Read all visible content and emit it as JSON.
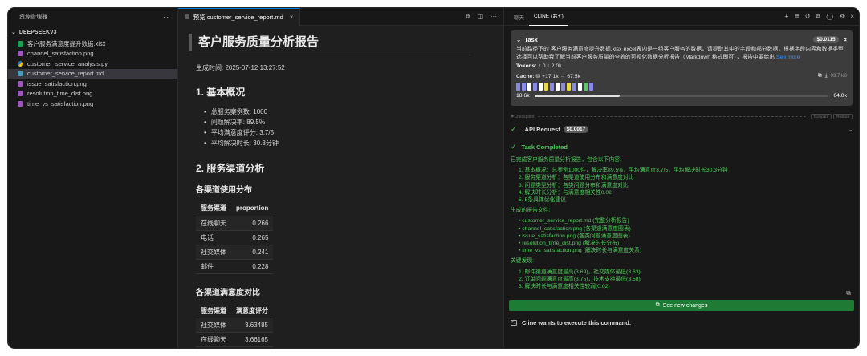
{
  "sidebar": {
    "title": "资源管理器",
    "more": "···",
    "section": "DEEPSEEKV3",
    "files": [
      {
        "name": "客户服务满意度提升数据.xlsx",
        "type": "xlsx"
      },
      {
        "name": "channel_satisfaction.png",
        "type": "png"
      },
      {
        "name": "customer_service_analysis.py",
        "type": "py"
      },
      {
        "name": "customer_service_report.md",
        "type": "md",
        "active": true
      },
      {
        "name": "issue_satisfaction.png",
        "type": "png"
      },
      {
        "name": "resolution_time_dist.png",
        "type": "png"
      },
      {
        "name": "time_vs_satisfaction.png",
        "type": "png"
      }
    ]
  },
  "editor": {
    "tab_label": "预览 customer_service_report.md",
    "doc": {
      "title": "客户服务质量分析报告",
      "generated": "生成时间: 2025-07-12 13:27:52",
      "s1_heading": "1. 基本概况",
      "s1_items": [
        "总服务案例数: 1000",
        "问题解决率: 89.5%",
        "平均满意度评分: 3.7/5",
        "平均解决时长: 30.3分钟"
      ],
      "s2_heading": "2. 服务渠道分析",
      "usage_heading": "各渠道使用分布",
      "usage_table": {
        "headers": [
          "服务渠道",
          "proportion"
        ],
        "rows": [
          [
            "在线聊天",
            "0.266"
          ],
          [
            "电话",
            "0.265"
          ],
          [
            "社交媒体",
            "0.241"
          ],
          [
            "邮件",
            "0.228"
          ]
        ]
      },
      "sat_heading": "各渠道满意度对比",
      "sat_table": {
        "headers": [
          "服务渠道",
          "满意度评分"
        ],
        "rows": [
          [
            "社交媒体",
            "3.63485"
          ],
          [
            "在线聊天",
            "3.66165"
          ]
        ]
      }
    }
  },
  "cline": {
    "tabs": [
      "聊天",
      "CLINE (⌘+')"
    ],
    "task": {
      "label": "Task",
      "cost": "$0.0115",
      "text": "当前路径下的`客户服务满意度提升数据.xlsx`excel表内是一组客户服务的数据，请提取其中的字段和部分数据，根据字段内容和数据类型选择可以帮助我了解当前客户服务质量的全貌的可视化数据分析报告（Markdown 格式即可），报告中要给出",
      "see_more": "See more",
      "tokens_label": "Tokens:",
      "tokens_value": "↑ 0 ↓ 2.0k",
      "cache_label": "Cache:",
      "cache_value": "+17.1k → 67.5k",
      "size": "93.7 kB",
      "ctx_used": "18.6k",
      "ctx_max": "64.0k",
      "ctx_used_value": 18.6,
      "ctx_max_value": 64.0
    },
    "checkpoint": {
      "label": "Checkpoint",
      "compare": "Compare",
      "restore": "Restore"
    },
    "api_request": {
      "label": "API Request",
      "cost": "$0.0017"
    },
    "completed": "Task Completed",
    "result": {
      "intro": "已完成客户服务质量分析报告，包含以下内容:",
      "contents": [
        "1. 基本概况：总案例1000件，解决率89.5%，平均满意度3.7/5，平均解决时长30.3分钟",
        "2. 服务渠道分析：各渠道使用分布和满意度对比",
        "3. 问题类型分析：各类问题分布和满意度对比",
        "4. 解决时长分析：与满意度相关性0.02",
        "5. 5条具体优化建议"
      ],
      "files_heading": "生成的报告文件:",
      "files": [
        "•  customer_service_report.md (完整分析报告)",
        "•  channel_satisfaction.png (各渠道满意度图表)",
        "•  issue_satisfaction.png (各类问题满意度图表)",
        "•  resolution_time_dist.png (解决时长分布)",
        "•  time_vs_satisfaction.png (解决时长与满意度关系)"
      ],
      "findings_heading": "关键发现:",
      "findings": [
        "1. 邮件渠道满意度最高(3.69)，社交媒体最低(3.63)",
        "2. 订单问题满意度最高(3.75)，技术支持最低(3.58)",
        "3. 解决时长与满意度相关性较弱(0.02)"
      ]
    },
    "see_changes": "See new changes",
    "execute": "Cline wants to execute this command:"
  }
}
